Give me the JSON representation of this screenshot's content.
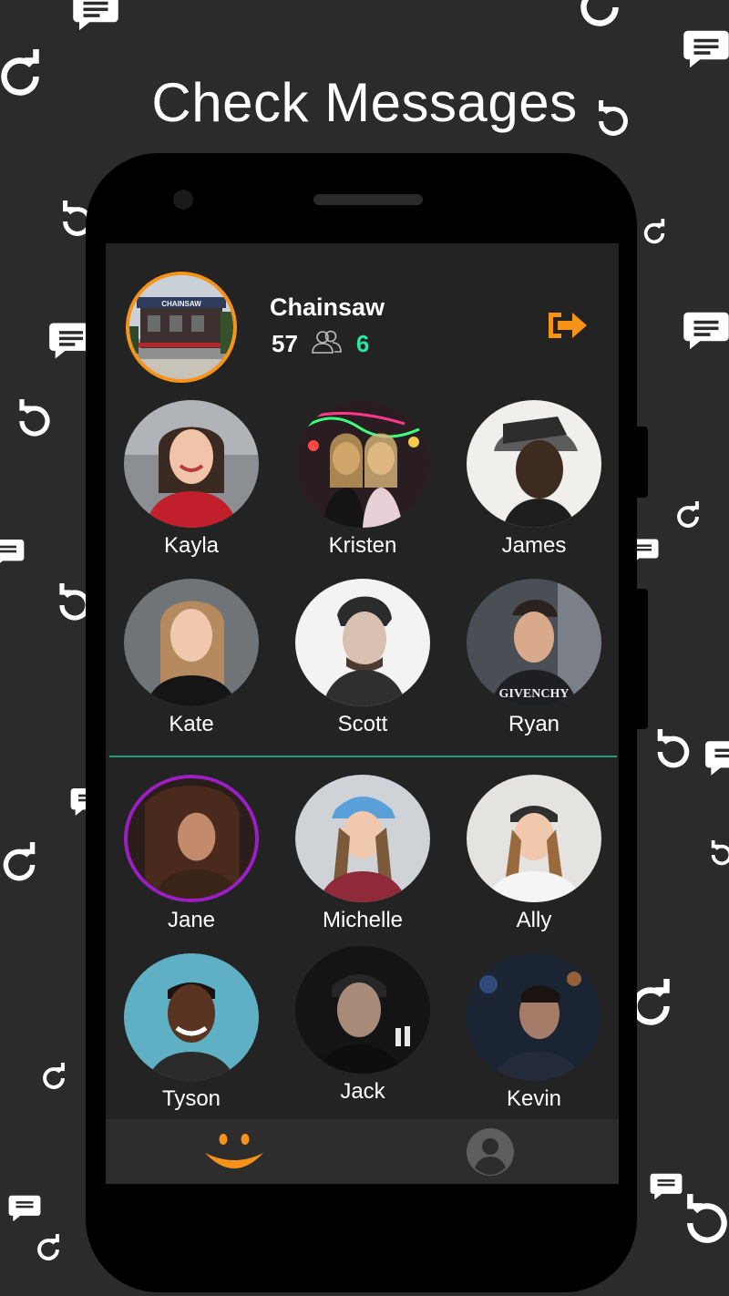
{
  "headline": "Check Messages",
  "venue": {
    "name": "Chainsaw",
    "sign_text": "CHAINSAW",
    "checkin_count": "57",
    "new_count": "6"
  },
  "colors": {
    "accent_orange": "#f7931a",
    "new_count_green": "#2ee59d",
    "divider_teal": "#1f9e78",
    "selected_ring_purple": "#9b1fc4"
  },
  "people_top": [
    {
      "name": "Kayla"
    },
    {
      "name": "Kristen"
    },
    {
      "name": "James"
    },
    {
      "name": "Kate"
    },
    {
      "name": "Scott"
    },
    {
      "name": "Ryan"
    }
  ],
  "people_bottom": [
    {
      "name": "Jane",
      "selected": true
    },
    {
      "name": "Michelle"
    },
    {
      "name": "Ally"
    },
    {
      "name": "Tyson"
    },
    {
      "name": "Jack"
    },
    {
      "name": "Kevin"
    }
  ],
  "nav": {
    "tabs": [
      {
        "icon": "smiley-icon",
        "active": true
      },
      {
        "icon": "profile-icon",
        "active": false
      }
    ]
  },
  "background_icons": [
    "chat-bubble-icon",
    "refresh-icon"
  ]
}
